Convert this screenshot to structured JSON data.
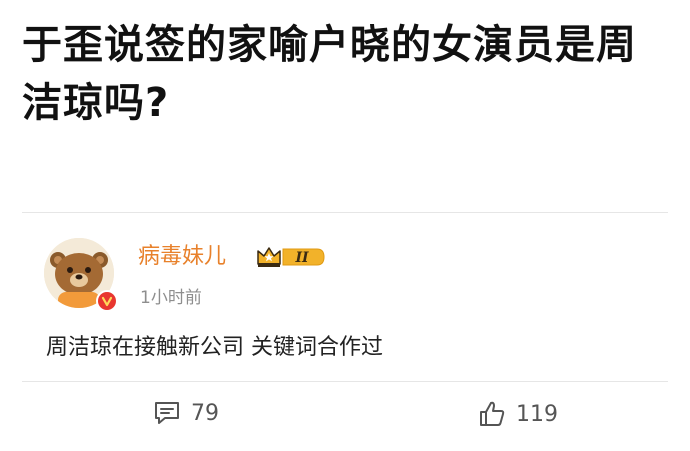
{
  "question": {
    "title": "于歪说签的家喻户晓的女演员是周洁琼吗?"
  },
  "answer": {
    "user": {
      "name": "病毒妹儿",
      "badge_level": "II"
    },
    "timestamp": "1小时前",
    "content": "周洁琼在接触新公司 关键词合作过"
  },
  "actions": {
    "comments": "79",
    "likes": "119"
  },
  "colors": {
    "username": "#e8812b",
    "verified": "#e8362f",
    "badge_gold": "#f2b22a"
  }
}
